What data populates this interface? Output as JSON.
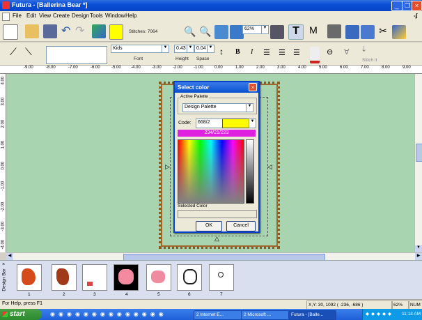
{
  "window": {
    "title": "Futura - [Ballerina Bear *]"
  },
  "menu": [
    "File",
    "Edit",
    "View",
    "Create",
    "Design",
    "Tools",
    "Window",
    "Help"
  ],
  "toolbar1": {
    "stitches_label": "Stitches: 7064",
    "zoom": "62%"
  },
  "toolbar2": {
    "font_value": "Kids",
    "font_label": "Font",
    "height_value": "0.43",
    "height_label": "Height",
    "space_value": "0.04",
    "space_label": "Space",
    "bold": "B",
    "italic": "I",
    "stitch_label": "Stitch it"
  },
  "hruler": [
    "-9.00",
    "-8.00",
    "-7.00",
    "-6.00",
    "-5.00",
    "-4.00",
    "-3.00",
    "-2.00",
    "-1.00",
    "0.00",
    "1.00",
    "2.00",
    "3.00",
    "4.00",
    "5.00",
    "6.00",
    "7.00",
    "8.00",
    "9.00"
  ],
  "vruler": [
    "4.00",
    "3.00",
    "2.00",
    "1.00",
    "0.00",
    "-1.00",
    "-2.00",
    "-3.00",
    "-4.00"
  ],
  "dialog": {
    "title": "Select color",
    "active_palette_label": "Active Palette",
    "palette_value": "Design Palette",
    "code_label": "Code:",
    "code_value": "668/2",
    "selected_swatch_color": "#ffff00",
    "rgb_text": "234/21/223",
    "rgb_bar_color": "#e020e0",
    "selected_color_label": "Selected Color",
    "ok": "OK",
    "cancel": "Cancel"
  },
  "designbar": {
    "label": "Design Bar",
    "thumbs": [
      "1",
      "2",
      "3",
      "4",
      "5",
      "6",
      "7"
    ]
  },
  "status": {
    "help": "For Help, press F1",
    "coords": "X,Y: 30, 1092  ( -236, -686 )",
    "zoom": "62%",
    "num": "NUM"
  },
  "taskbar": {
    "start": "start",
    "tasks": [
      "2 Internet E...",
      "2 Microsoft ...",
      "Futura - [Balle..."
    ],
    "clock": "11:13 AM"
  }
}
